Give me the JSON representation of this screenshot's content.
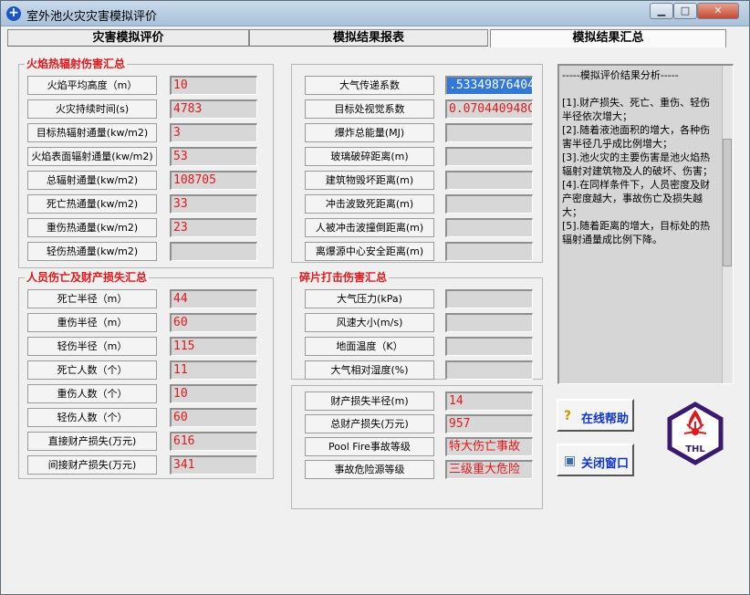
{
  "window": {
    "title": "室外池火灾灾害模拟评价"
  },
  "tabs": [
    {
      "label": "灾害模拟评价"
    },
    {
      "label": "模拟结果报表"
    },
    {
      "label": "模拟结果汇总"
    }
  ],
  "flame_group": {
    "title": "火焰热辐射伤害汇总",
    "rows": [
      {
        "label": "火焰平均高度（m）",
        "value": "10"
      },
      {
        "label": "火灾持续时间(s)",
        "value": "4783"
      },
      {
        "label": "目标热辐射通量(kw/m2)",
        "value": "3"
      },
      {
        "label": "火焰表面辐射通量(kw/m2)",
        "value": "53"
      },
      {
        "label": "总辐射通量(kw/m2)",
        "value": "108705"
      },
      {
        "label": "死亡热通量(kw/m2)",
        "value": "33"
      },
      {
        "label": "重伤热通量(kw/m2)",
        "value": "23"
      },
      {
        "label": "轻伤热通量(kw/m2)",
        "value": ""
      }
    ]
  },
  "people_group": {
    "title": "人员伤亡及财产损失汇总",
    "rows": [
      {
        "label": "死亡半径（m）",
        "value": "44"
      },
      {
        "label": "重伤半径（m）",
        "value": "60"
      },
      {
        "label": "轻伤半径（m）",
        "value": "115"
      },
      {
        "label": "死亡人数（个）",
        "value": "11"
      },
      {
        "label": "重伤人数（个）",
        "value": "10"
      },
      {
        "label": "轻伤人数（个）",
        "value": "60"
      },
      {
        "label": "直接财产损失(万元)",
        "value": "616"
      },
      {
        "label": "间接财产损失(万元)",
        "value": "341"
      }
    ]
  },
  "atmos_group": {
    "rows": [
      {
        "label": "大气传递系数",
        "value": ".53349876404"
      },
      {
        "label": "目标处视觉系数",
        "value": "0.070440948C"
      },
      {
        "label": "爆炸总能量(MJ)",
        "value": ""
      },
      {
        "label": "玻璃破碎距离(m)",
        "value": ""
      },
      {
        "label": "建筑物毁坏距离(m)",
        "value": ""
      },
      {
        "label": "冲击波致死距离(m)",
        "value": ""
      },
      {
        "label": "人被冲击波撞倒距离(m)",
        "value": ""
      },
      {
        "label": "离爆源中心安全距离(m)",
        "value": ""
      }
    ]
  },
  "debris_group": {
    "title": "碎片打击伤害汇总",
    "rows": [
      {
        "label": "大气压力(kPa)",
        "value": ""
      },
      {
        "label": "风速大小(m/s)",
        "value": ""
      },
      {
        "label": "地面温度（K）",
        "value": ""
      },
      {
        "label": "大气相对湿度(%)",
        "value": ""
      }
    ]
  },
  "loss_group": {
    "rows": [
      {
        "label": "财产损失半径(m)",
        "value": "14"
      },
      {
        "label": "总财产损失(万元)",
        "value": "957"
      },
      {
        "label": "Pool Fire事故等级",
        "value": "特大伤亡事故"
      },
      {
        "label": "事故危险源等级",
        "value": "三级重大危险"
      }
    ]
  },
  "analysis": {
    "lines": [
      "-----模拟评价结果分析-----",
      "",
      "[1].财产损失、死亡、重伤、轻伤半径依次增大；",
      "[2].随着液池面积的增大，各种伤害半径几乎成比例增大；",
      "[3].池火灾的主要伤害是池火焰热辐射对建筑物及人的破坏、伤害；",
      "[4].在同样条件下，人员密度及财产密度越大，事故伤亡及损失越大；",
      "[5].随着距离的增大，目标处的热辐射通量成比例下降。"
    ]
  },
  "buttons": {
    "help_label": "在线帮助",
    "close_label": "关闭窗口"
  },
  "logo": {
    "text": "THL"
  },
  "colors": {
    "accent_red": "#e0191c",
    "highlight_blue": "#3278d8",
    "button_text": "#1036c9"
  }
}
